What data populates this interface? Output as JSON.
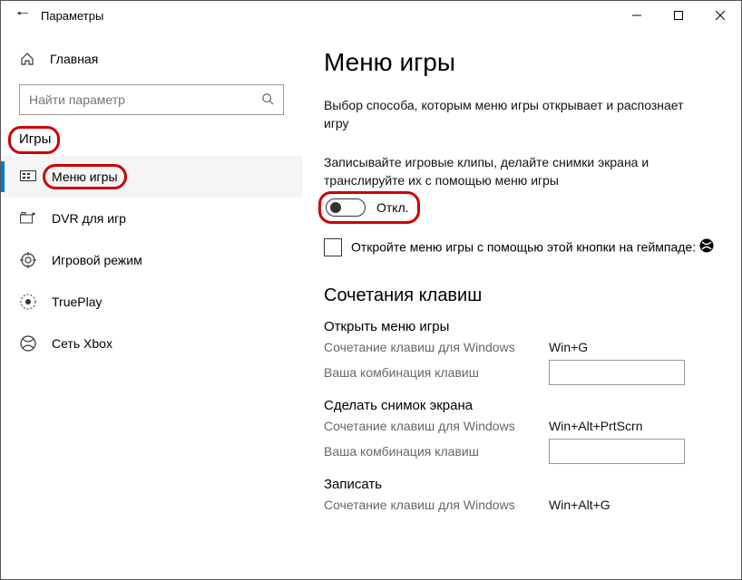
{
  "titlebar": {
    "title": "Параметры"
  },
  "sidebar": {
    "home": "Главная",
    "search_placeholder": "Найти параметр",
    "section": "Игры",
    "items": [
      {
        "label": "Меню игры"
      },
      {
        "label": "DVR для игр"
      },
      {
        "label": "Игровой режим"
      },
      {
        "label": "TruePlay"
      },
      {
        "label": "Сеть Xbox"
      }
    ]
  },
  "content": {
    "heading": "Меню игры",
    "description": "Выбор способа, которым меню игры открывает и распознает игру",
    "toggle_section": "Записывайте игровые клипы, делайте снимки экрана и транслируйте их с помощью меню игры",
    "toggle_state": "Откл.",
    "checkbox_text": "Откройте меню игры с помощью этой кнопки на геймпаде:",
    "shortcuts_heading": "Сочетания клавиш",
    "sc_label_win": "Сочетание клавиш для Windows",
    "sc_label_your": "Ваша комбинация клавиш",
    "shortcuts": [
      {
        "title": "Открыть меню игры",
        "win": "Win+G"
      },
      {
        "title": "Сделать снимок экрана",
        "win": "Win+Alt+PrtScrn"
      },
      {
        "title": "Записать",
        "win": "Win+Alt+G"
      }
    ]
  }
}
